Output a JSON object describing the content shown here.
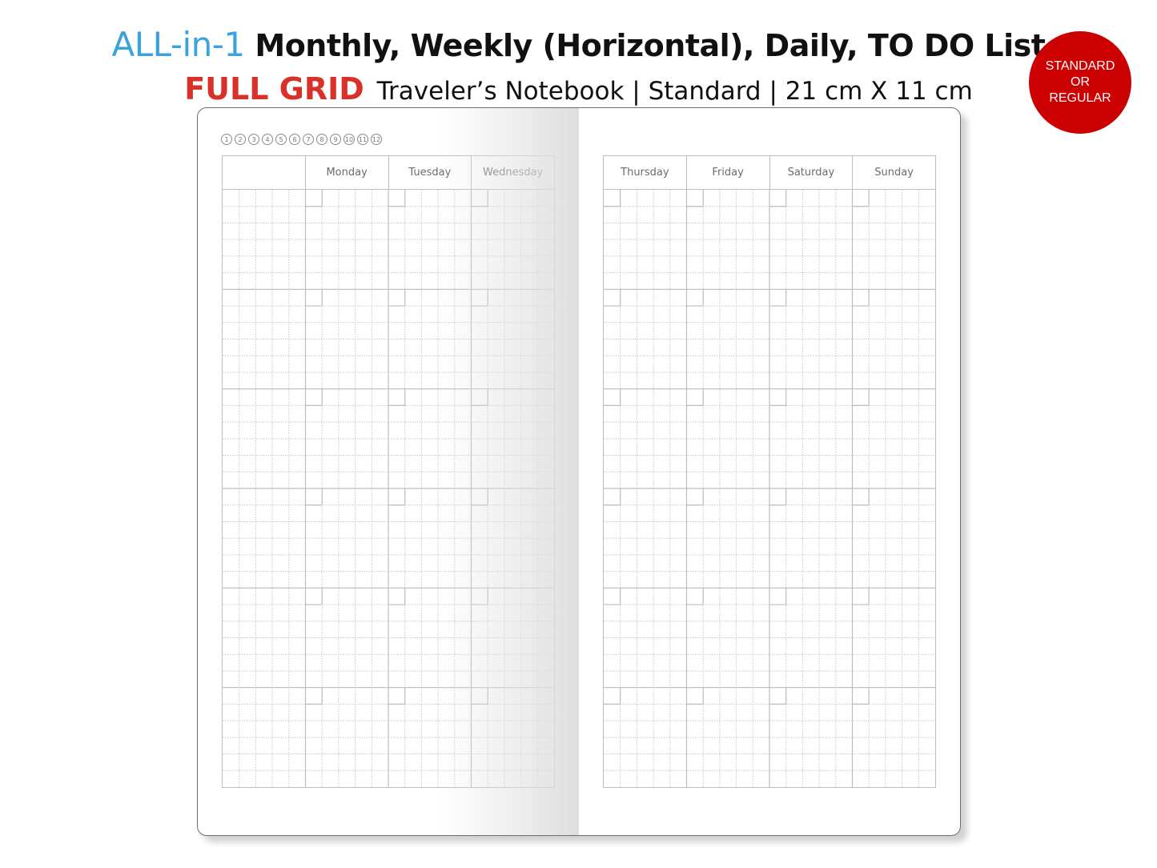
{
  "header": {
    "line1_highlight": "ALL-in-1",
    "line1_rest": "Monthly, Weekly (Horizontal), Daily, TO DO List",
    "line2_highlight": "FULL GRID",
    "line2_rest": "Traveler’s Notebook | Standard | 21 cm X 11 cm"
  },
  "badge": {
    "lines": [
      "STANDARD",
      "OR",
      "REGULAR"
    ],
    "color": "#cc0000"
  },
  "colors": {
    "accent_blue": "#3aa3dc",
    "accent_red": "#d9302a",
    "grid_line": "#bdbdbd"
  },
  "notebook": {
    "month_tabs": [
      "1",
      "2",
      "3",
      "4",
      "5",
      "6",
      "7",
      "8",
      "9",
      "10",
      "11",
      "12"
    ],
    "left_page": {
      "columns": [
        "",
        "Monday",
        "Tuesday",
        "Wednesday"
      ]
    },
    "right_page": {
      "columns": [
        "Thursday",
        "Friday",
        "Saturday",
        "Sunday"
      ]
    },
    "blocks_per_page": 6,
    "rows_per_block": 6,
    "cells_per_column": 5
  }
}
